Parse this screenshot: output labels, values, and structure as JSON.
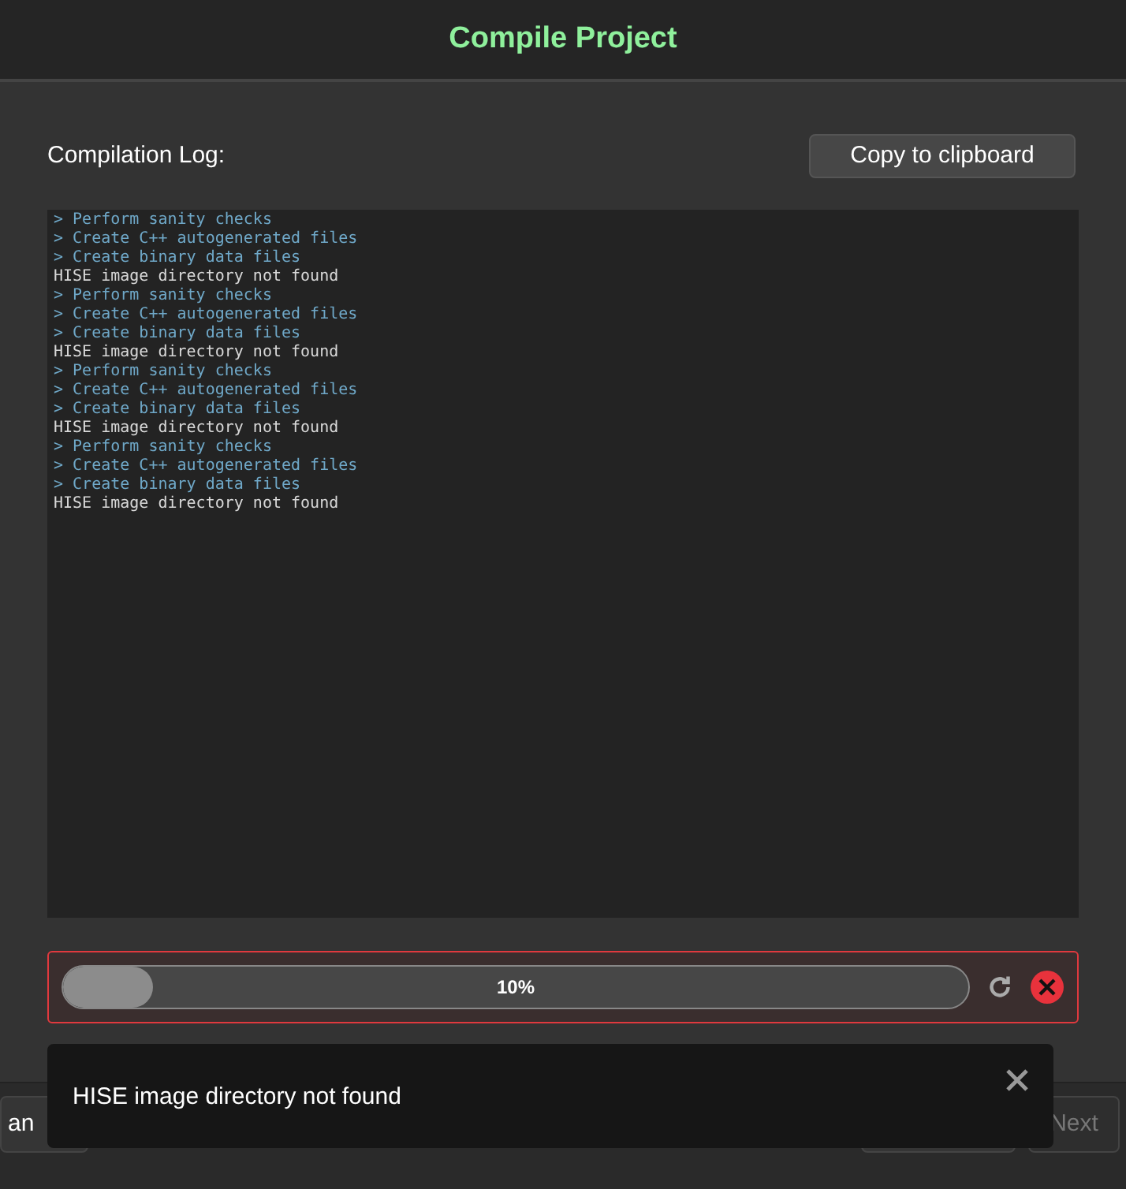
{
  "window": {
    "title": "Compile Project"
  },
  "log": {
    "label": "Compilation Log:",
    "copy_button": "Copy to clipboard",
    "lines": [
      {
        "kind": "command",
        "text": "> Perform sanity checks"
      },
      {
        "kind": "command",
        "text": "> Create C++ autogenerated files"
      },
      {
        "kind": "command",
        "text": "> Create binary data files"
      },
      {
        "kind": "message",
        "text": "HISE image directory not found"
      },
      {
        "kind": "command",
        "text": "> Perform sanity checks"
      },
      {
        "kind": "command",
        "text": "> Create C++ autogenerated files"
      },
      {
        "kind": "command",
        "text": "> Create binary data files"
      },
      {
        "kind": "message",
        "text": "HISE image directory not found"
      },
      {
        "kind": "command",
        "text": "> Perform sanity checks"
      },
      {
        "kind": "command",
        "text": "> Create C++ autogenerated files"
      },
      {
        "kind": "command",
        "text": "> Create binary data files"
      },
      {
        "kind": "message",
        "text": "HISE image directory not found"
      },
      {
        "kind": "command",
        "text": "> Perform sanity checks"
      },
      {
        "kind": "command",
        "text": "> Create C++ autogenerated files"
      },
      {
        "kind": "command",
        "text": "> Create binary data files"
      },
      {
        "kind": "message",
        "text": "HISE image directory not found"
      }
    ]
  },
  "progress": {
    "level": 0.1,
    "reading": "10%",
    "error": true
  },
  "toast": {
    "message": "HISE image directory not found"
  },
  "footer": {
    "cancel": "an",
    "next": "Next"
  }
}
